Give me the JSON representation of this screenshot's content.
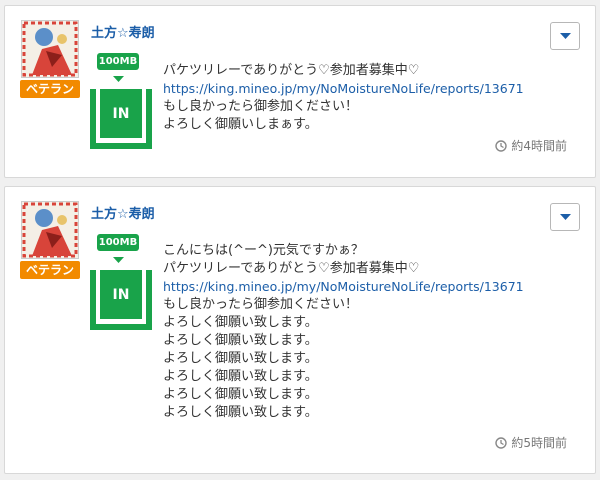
{
  "posts": [
    {
      "username": "土方☆寿朗",
      "badge": "ベテラン",
      "data_tag": "100MB",
      "direction": "IN",
      "lines": [
        "パケツリレーでありがとう♡参加者募集中♡",
        "https://king.mineo.jp/my/NoMoistureNoLife/reports/13671",
        "もし良かったら御参加ください！",
        "よろしく御願いしまぁす。"
      ],
      "timestamp": "約4時間前"
    },
    {
      "username": "土方☆寿朗",
      "badge": "ベテラン",
      "data_tag": "100MB",
      "direction": "IN",
      "lines": [
        "こんにちは(^ー^)元気ですかぁ？",
        "パケツリレーでありがとう♡参加者募集中♡",
        "https://king.mineo.jp/my/NoMoistureNoLife/reports/13671",
        "もし良かったら御参加ください！",
        "よろしく御願い致します。",
        "よろしく御願い致します。",
        "よろしく御願い致します。",
        "よろしく御願い致します。",
        "よろしく御願い致します。",
        "よろしく御願い致します。"
      ],
      "timestamp": "約5時間前"
    }
  ],
  "icons": {
    "dropdown": "chevron-down-icon",
    "clock": "clock-icon",
    "arrow": "down-arrow-icon"
  },
  "colors": {
    "accent_green": "#19a34a",
    "badge_orange": "#f28a00",
    "link_blue": "#1c5ea8"
  }
}
